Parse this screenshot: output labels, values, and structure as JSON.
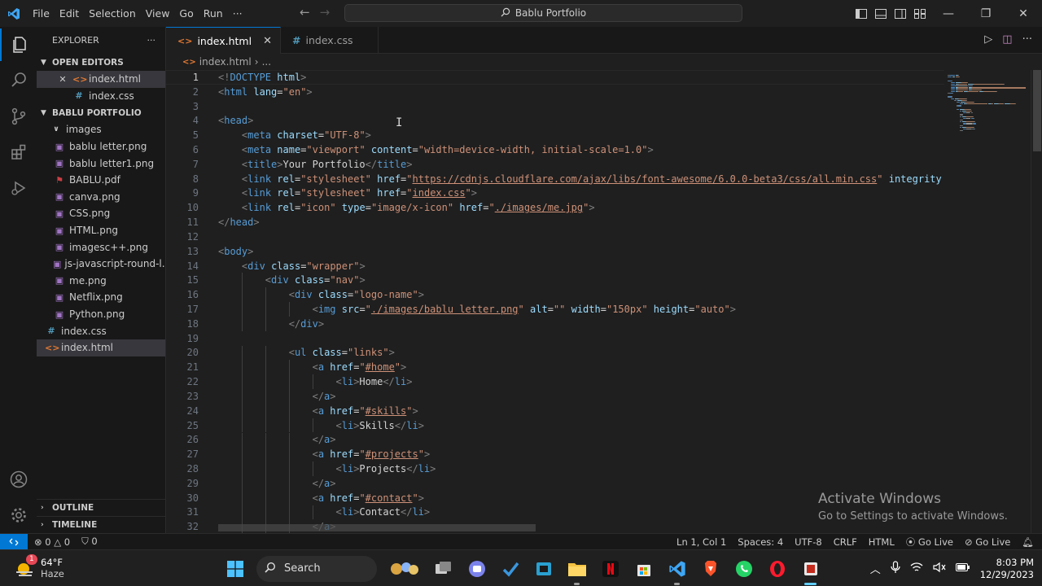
{
  "titlebar": {
    "menu": [
      "File",
      "Edit",
      "Selection",
      "View",
      "Go",
      "Run",
      "···"
    ],
    "search_text": "Bablu Portfolio"
  },
  "sidebar": {
    "title": "EXPLORER",
    "more": "···",
    "open_editors_label": "OPEN EDITORS",
    "open_editors": [
      {
        "name": "index.html",
        "type": "html"
      },
      {
        "name": "index.css",
        "type": "css"
      }
    ],
    "project_label": "BABLU PORTFOLIO",
    "folder": "images",
    "images": [
      {
        "name": "bablu letter.png",
        "type": "png"
      },
      {
        "name": "bablu letter1.png",
        "type": "png"
      },
      {
        "name": "BABLU.pdf",
        "type": "pdf"
      },
      {
        "name": "canva.png",
        "type": "png"
      },
      {
        "name": "CSS.png",
        "type": "png"
      },
      {
        "name": "HTML.png",
        "type": "png"
      },
      {
        "name": "imagesc++.png",
        "type": "png"
      },
      {
        "name": "js-javascript-round-l...",
        "type": "png"
      },
      {
        "name": "me.png",
        "type": "png"
      },
      {
        "name": "Netflix.png",
        "type": "png"
      },
      {
        "name": "Python.png",
        "type": "png"
      }
    ],
    "root_files": [
      {
        "name": "index.css",
        "type": "css"
      },
      {
        "name": "index.html",
        "type": "html"
      }
    ],
    "outline_label": "OUTLINE",
    "timeline_label": "TIMELINE"
  },
  "tabs": [
    {
      "label": "index.html",
      "type": "html",
      "active": true
    },
    {
      "label": "index.css",
      "type": "css",
      "active": false
    }
  ],
  "breadcrumb": {
    "file": "index.html",
    "rest": "..."
  },
  "editor": {
    "current_line": 1,
    "lines": [
      [
        [
          "br",
          "<!"
        ],
        [
          "tag",
          "DOCTYPE"
        ],
        [
          "text",
          " "
        ],
        [
          "attr",
          "html"
        ],
        [
          "br",
          ">"
        ]
      ],
      [
        [
          "br",
          "<"
        ],
        [
          "tag",
          "html"
        ],
        [
          "text",
          " "
        ],
        [
          "attr",
          "lang"
        ],
        [
          "text",
          "="
        ],
        [
          "str",
          "\"en\""
        ],
        [
          "br",
          ">"
        ]
      ],
      [],
      [
        [
          "br",
          "<"
        ],
        [
          "tag",
          "head"
        ],
        [
          "br",
          ">"
        ]
      ],
      [
        [
          "text",
          "    "
        ],
        [
          "br",
          "<"
        ],
        [
          "tag",
          "meta"
        ],
        [
          "text",
          " "
        ],
        [
          "attr",
          "charset"
        ],
        [
          "text",
          "="
        ],
        [
          "str",
          "\"UTF-8\""
        ],
        [
          "br",
          ">"
        ]
      ],
      [
        [
          "text",
          "    "
        ],
        [
          "br",
          "<"
        ],
        [
          "tag",
          "meta"
        ],
        [
          "text",
          " "
        ],
        [
          "attr",
          "name"
        ],
        [
          "text",
          "="
        ],
        [
          "str",
          "\"viewport\""
        ],
        [
          "text",
          " "
        ],
        [
          "attr",
          "content"
        ],
        [
          "text",
          "="
        ],
        [
          "str",
          "\"width=device-width, initial-scale=1.0\""
        ],
        [
          "br",
          ">"
        ]
      ],
      [
        [
          "text",
          "    "
        ],
        [
          "br",
          "<"
        ],
        [
          "tag",
          "title"
        ],
        [
          "br",
          ">"
        ],
        [
          "text",
          "Your Portfolio"
        ],
        [
          "br",
          "</"
        ],
        [
          "tag",
          "title"
        ],
        [
          "br",
          ">"
        ]
      ],
      [
        [
          "text",
          "    "
        ],
        [
          "br",
          "<"
        ],
        [
          "tag",
          "link"
        ],
        [
          "text",
          " "
        ],
        [
          "attr",
          "rel"
        ],
        [
          "text",
          "="
        ],
        [
          "str",
          "\"stylesheet\""
        ],
        [
          "text",
          " "
        ],
        [
          "attr",
          "href"
        ],
        [
          "text",
          "="
        ],
        [
          "str",
          "\""
        ],
        [
          "link",
          "https://cdnjs.cloudflare.com/ajax/libs/font-awesome/6.0.0-beta3/css/all.min.css"
        ],
        [
          "str",
          "\""
        ],
        [
          "text",
          " "
        ],
        [
          "attr",
          "integrity"
        ]
      ],
      [
        [
          "text",
          "    "
        ],
        [
          "br",
          "<"
        ],
        [
          "tag",
          "link"
        ],
        [
          "text",
          " "
        ],
        [
          "attr",
          "rel"
        ],
        [
          "text",
          "="
        ],
        [
          "str",
          "\"stylesheet\""
        ],
        [
          "text",
          " "
        ],
        [
          "attr",
          "href"
        ],
        [
          "text",
          "="
        ],
        [
          "str",
          "\""
        ],
        [
          "link",
          "index.css"
        ],
        [
          "str",
          "\""
        ],
        [
          "br",
          ">"
        ]
      ],
      [
        [
          "text",
          "    "
        ],
        [
          "br",
          "<"
        ],
        [
          "tag",
          "link"
        ],
        [
          "text",
          " "
        ],
        [
          "attr",
          "rel"
        ],
        [
          "text",
          "="
        ],
        [
          "str",
          "\"icon\""
        ],
        [
          "text",
          " "
        ],
        [
          "attr",
          "type"
        ],
        [
          "text",
          "="
        ],
        [
          "str",
          "\"image/x-icon\""
        ],
        [
          "text",
          " "
        ],
        [
          "attr",
          "href"
        ],
        [
          "text",
          "="
        ],
        [
          "str",
          "\""
        ],
        [
          "link",
          "./images/me.jpg"
        ],
        [
          "str",
          "\""
        ],
        [
          "br",
          ">"
        ]
      ],
      [
        [
          "br",
          "</"
        ],
        [
          "tag",
          "head"
        ],
        [
          "br",
          ">"
        ]
      ],
      [],
      [
        [
          "br",
          "<"
        ],
        [
          "tag",
          "body"
        ],
        [
          "br",
          ">"
        ]
      ],
      [
        [
          "text",
          "    "
        ],
        [
          "br",
          "<"
        ],
        [
          "tag",
          "div"
        ],
        [
          "text",
          " "
        ],
        [
          "attr",
          "class"
        ],
        [
          "text",
          "="
        ],
        [
          "str",
          "\"wrapper\""
        ],
        [
          "br",
          ">"
        ]
      ],
      [
        [
          "text",
          "        "
        ],
        [
          "br",
          "<"
        ],
        [
          "tag",
          "div"
        ],
        [
          "text",
          " "
        ],
        [
          "attr",
          "class"
        ],
        [
          "text",
          "="
        ],
        [
          "str",
          "\"nav\""
        ],
        [
          "br",
          ">"
        ]
      ],
      [
        [
          "text",
          "            "
        ],
        [
          "br",
          "<"
        ],
        [
          "tag",
          "div"
        ],
        [
          "text",
          " "
        ],
        [
          "attr",
          "class"
        ],
        [
          "text",
          "="
        ],
        [
          "str",
          "\"logo-name\""
        ],
        [
          "br",
          ">"
        ]
      ],
      [
        [
          "text",
          "                "
        ],
        [
          "br",
          "<"
        ],
        [
          "tag",
          "img"
        ],
        [
          "text",
          " "
        ],
        [
          "attr",
          "src"
        ],
        [
          "text",
          "="
        ],
        [
          "str",
          "\""
        ],
        [
          "link",
          "./images/bablu letter.png"
        ],
        [
          "str",
          "\""
        ],
        [
          "text",
          " "
        ],
        [
          "attr",
          "alt"
        ],
        [
          "text",
          "="
        ],
        [
          "str",
          "\"\""
        ],
        [
          "text",
          " "
        ],
        [
          "attr",
          "width"
        ],
        [
          "text",
          "="
        ],
        [
          "str",
          "\"150px\""
        ],
        [
          "text",
          " "
        ],
        [
          "attr",
          "height"
        ],
        [
          "text",
          "="
        ],
        [
          "str",
          "\"auto\""
        ],
        [
          "br",
          ">"
        ]
      ],
      [
        [
          "text",
          "            "
        ],
        [
          "br",
          "</"
        ],
        [
          "tag",
          "div"
        ],
        [
          "br",
          ">"
        ]
      ],
      [],
      [
        [
          "text",
          "            "
        ],
        [
          "br",
          "<"
        ],
        [
          "tag",
          "ul"
        ],
        [
          "text",
          " "
        ],
        [
          "attr",
          "class"
        ],
        [
          "text",
          "="
        ],
        [
          "str",
          "\"links\""
        ],
        [
          "br",
          ">"
        ]
      ],
      [
        [
          "text",
          "                "
        ],
        [
          "br",
          "<"
        ],
        [
          "tag",
          "a"
        ],
        [
          "text",
          " "
        ],
        [
          "attr",
          "href"
        ],
        [
          "text",
          "="
        ],
        [
          "str",
          "\""
        ],
        [
          "link",
          "#home"
        ],
        [
          "str",
          "\""
        ],
        [
          "br",
          ">"
        ]
      ],
      [
        [
          "text",
          "                    "
        ],
        [
          "br",
          "<"
        ],
        [
          "tag",
          "li"
        ],
        [
          "br",
          ">"
        ],
        [
          "text",
          "Home"
        ],
        [
          "br",
          "</"
        ],
        [
          "tag",
          "li"
        ],
        [
          "br",
          ">"
        ]
      ],
      [
        [
          "text",
          "                "
        ],
        [
          "br",
          "</"
        ],
        [
          "tag",
          "a"
        ],
        [
          "br",
          ">"
        ]
      ],
      [
        [
          "text",
          "                "
        ],
        [
          "br",
          "<"
        ],
        [
          "tag",
          "a"
        ],
        [
          "text",
          " "
        ],
        [
          "attr",
          "href"
        ],
        [
          "text",
          "="
        ],
        [
          "str",
          "\""
        ],
        [
          "link",
          "#skills"
        ],
        [
          "str",
          "\""
        ],
        [
          "br",
          ">"
        ]
      ],
      [
        [
          "text",
          "                    "
        ],
        [
          "br",
          "<"
        ],
        [
          "tag",
          "li"
        ],
        [
          "br",
          ">"
        ],
        [
          "text",
          "Skills"
        ],
        [
          "br",
          "</"
        ],
        [
          "tag",
          "li"
        ],
        [
          "br",
          ">"
        ]
      ],
      [
        [
          "text",
          "                "
        ],
        [
          "br",
          "</"
        ],
        [
          "tag",
          "a"
        ],
        [
          "br",
          ">"
        ]
      ],
      [
        [
          "text",
          "                "
        ],
        [
          "br",
          "<"
        ],
        [
          "tag",
          "a"
        ],
        [
          "text",
          " "
        ],
        [
          "attr",
          "href"
        ],
        [
          "text",
          "="
        ],
        [
          "str",
          "\""
        ],
        [
          "link",
          "#projects"
        ],
        [
          "str",
          "\""
        ],
        [
          "br",
          ">"
        ]
      ],
      [
        [
          "text",
          "                    "
        ],
        [
          "br",
          "<"
        ],
        [
          "tag",
          "li"
        ],
        [
          "br",
          ">"
        ],
        [
          "text",
          "Projects"
        ],
        [
          "br",
          "</"
        ],
        [
          "tag",
          "li"
        ],
        [
          "br",
          ">"
        ]
      ],
      [
        [
          "text",
          "                "
        ],
        [
          "br",
          "</"
        ],
        [
          "tag",
          "a"
        ],
        [
          "br",
          ">"
        ]
      ],
      [
        [
          "text",
          "                "
        ],
        [
          "br",
          "<"
        ],
        [
          "tag",
          "a"
        ],
        [
          "text",
          " "
        ],
        [
          "attr",
          "href"
        ],
        [
          "text",
          "="
        ],
        [
          "str",
          "\""
        ],
        [
          "link",
          "#contact"
        ],
        [
          "str",
          "\""
        ],
        [
          "br",
          ">"
        ]
      ],
      [
        [
          "text",
          "                    "
        ],
        [
          "br",
          "<"
        ],
        [
          "tag",
          "li"
        ],
        [
          "br",
          ">"
        ],
        [
          "text",
          "Contact"
        ],
        [
          "br",
          "</"
        ],
        [
          "tag",
          "li"
        ],
        [
          "br",
          ">"
        ]
      ],
      [
        [
          "text",
          "                "
        ],
        [
          "br",
          "</"
        ],
        [
          "tag",
          "a"
        ],
        [
          "br",
          ">"
        ]
      ]
    ]
  },
  "watermark": {
    "line1": "Activate Windows",
    "line2": "Go to Settings to activate Windows."
  },
  "statusbar": {
    "errors": "0",
    "warnings": "0",
    "ports": "0",
    "position": "Ln 1, Col 1",
    "spaces": "Spaces: 4",
    "encoding": "UTF-8",
    "eol": "CRLF",
    "language": "HTML",
    "golive1": "Go Live",
    "golive2": "Go Live"
  },
  "taskbar": {
    "temp": "64°F",
    "condition": "Haze",
    "badge": "1",
    "search_label": "Search",
    "time": "8:03 PM",
    "date": "12/29/2023"
  },
  "colors": {
    "accent": "#0078d4",
    "tag": "#569cd6",
    "attr": "#9cdcfe",
    "string": "#ce9178"
  }
}
